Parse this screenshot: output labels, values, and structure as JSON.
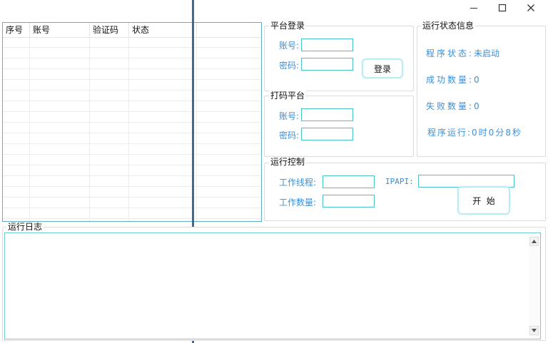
{
  "window": {
    "minimize": "minimize",
    "maximize": "maximize",
    "close": "close"
  },
  "table": {
    "columns": [
      "序号",
      "账号",
      "验证码",
      "状态"
    ],
    "rows": []
  },
  "platform_login": {
    "title": "平台登录",
    "account_label": "账号:",
    "account_value": "",
    "password_label": "密码:",
    "password_value": "",
    "login_button": "登录"
  },
  "captcha_platform": {
    "title": "打码平台",
    "account_label": "账号:",
    "account_value": "",
    "password_label": "密码:",
    "password_value": ""
  },
  "run_status": {
    "title": "运行状态信息",
    "program_status_label": "程序状态:",
    "program_status_value": "未启动",
    "success_label": "成功数量:",
    "success_value": "0",
    "fail_label": "失败数量:",
    "fail_value": "0",
    "runtime_label": "程序运行:",
    "runtime_value": "0时0分8秒"
  },
  "run_control": {
    "title": "运行控制",
    "threads_label": "工作线程:",
    "threads_value": "",
    "count_label": "工作数量:",
    "count_value": "",
    "ipapi_label": "IPAPI:",
    "ipapi_value": "",
    "start_button": "开  始"
  },
  "log": {
    "title": "运行日志",
    "content": ""
  },
  "colors": {
    "accent_blue": "#3d8fd6",
    "input_border": "#49c2c8",
    "splitter": "#3f6a96"
  }
}
